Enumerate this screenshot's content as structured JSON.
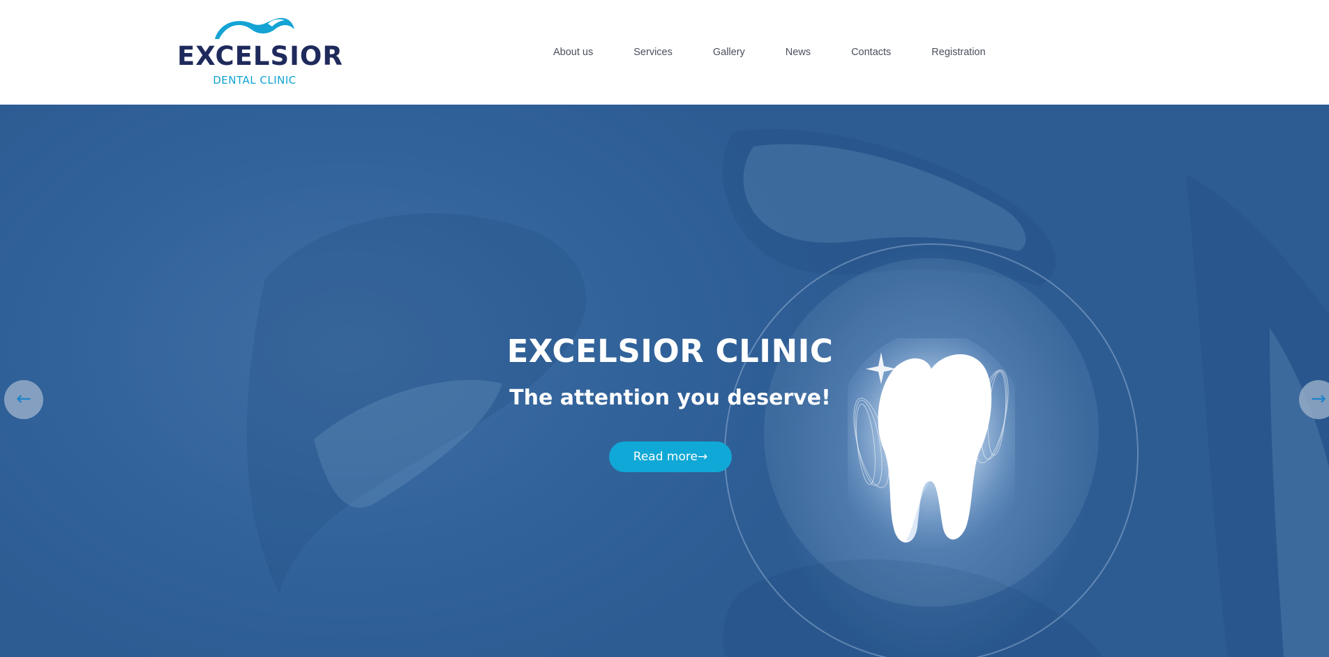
{
  "brand": {
    "name": "EXCELSIOR",
    "tagline": "DENTAL CLINIC",
    "colors": {
      "navy": "#1f2a5c",
      "accent": "#10a8d6",
      "hero": "#31629a"
    }
  },
  "nav": {
    "items": [
      {
        "label": "About us"
      },
      {
        "label": "Services"
      },
      {
        "label": "Gallery"
      },
      {
        "label": "News"
      },
      {
        "label": "Contacts"
      },
      {
        "label": "Registration"
      }
    ]
  },
  "hero": {
    "title": "EXCELSIOR CLINIC",
    "subtitle": "The attention you deserve!",
    "button_label": "Read more→",
    "prev_icon": "←",
    "next_icon": "→",
    "image_icon": "tooth-icon"
  }
}
